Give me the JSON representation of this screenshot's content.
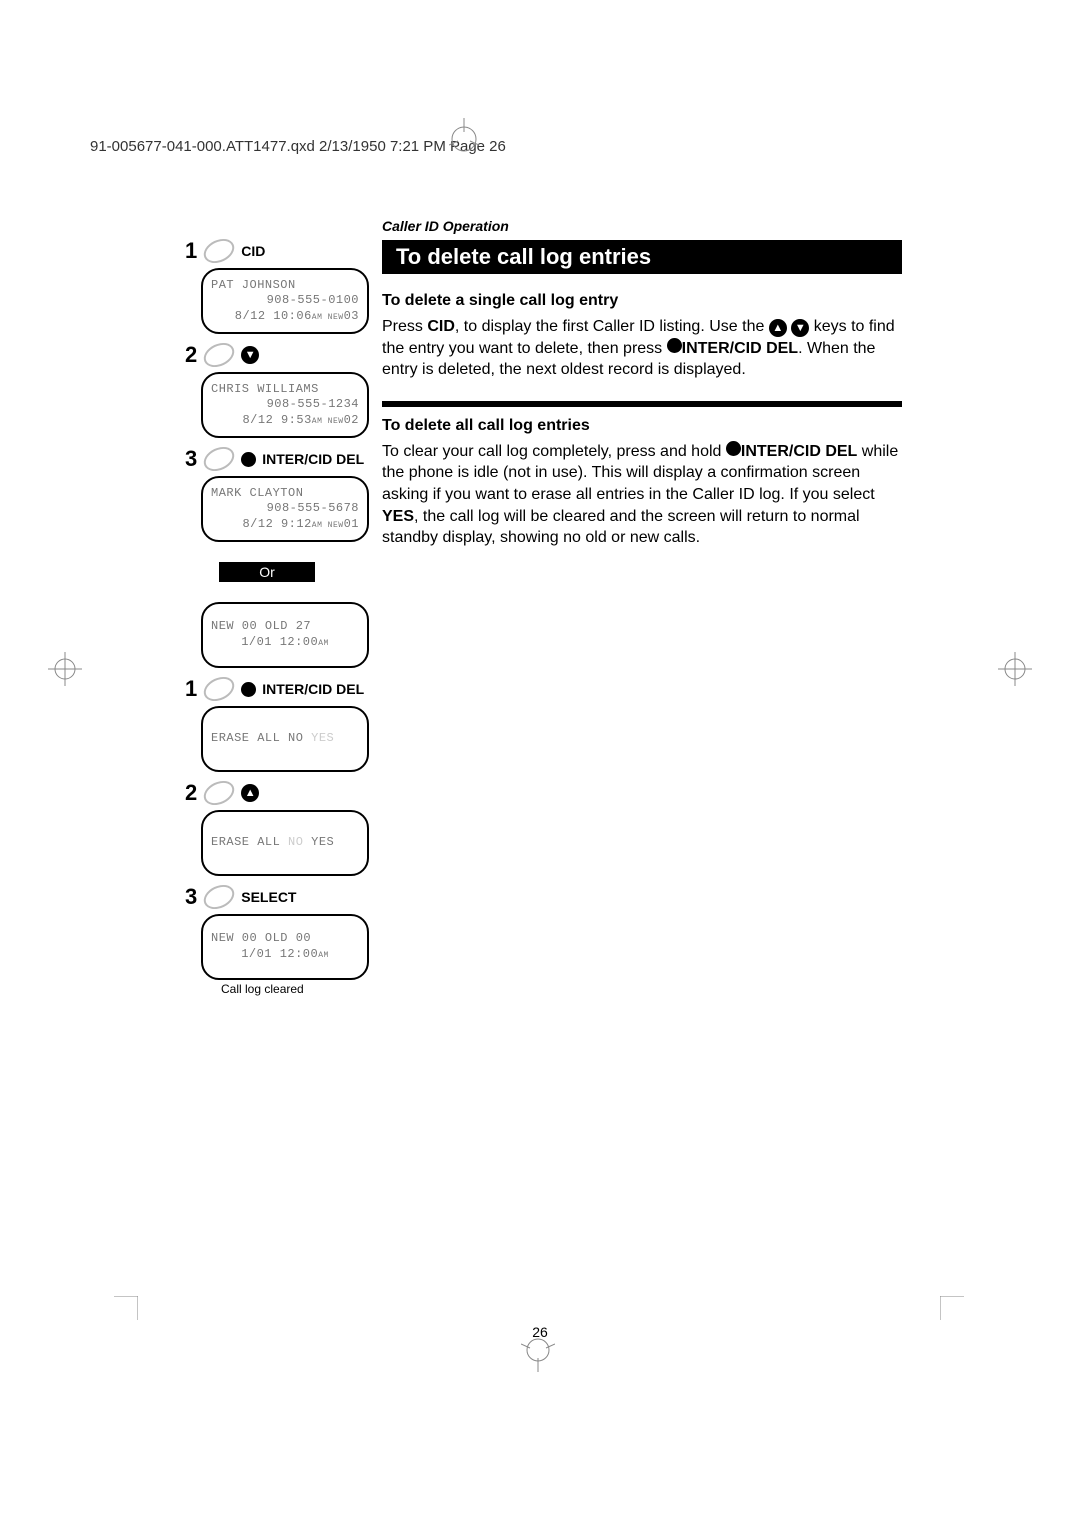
{
  "header_line": "91-005677-041-000.ATT1477.qxd  2/13/1950  7:21 PM  Page 26",
  "right": {
    "section_label": "Caller ID Operation",
    "title": "To delete call log entries",
    "sub1": "To delete a single call log entry",
    "para1a": "Press ",
    "para1_cid": "CID",
    "para1b": ", to display the first Caller ID listing. Use the ",
    "para1c": " keys to find the entry you want to delete, then press ",
    "para1_inter": "INTER/CID DEL",
    "para1d": ". When the entry is deleted, the next oldest record is displayed.",
    "sub2": "To delete all call log entries",
    "para2a": "To clear your call log completely, press and hold ",
    "para2_inter": "INTER/CID DEL",
    "para2b": " while the phone is idle (not in use). This will display a confirmation screen asking if you want to erase all entries in the Caller ID log. If you select ",
    "para2_yes": "YES",
    "para2c": ", the call log will be cleared and the screen will return to normal standby display, showing no old or new calls."
  },
  "left": {
    "step1a": "1",
    "step1a_label": "CID",
    "lcd1": {
      "r1": "PAT JOHNSON",
      "r2": "908-555-0100",
      "r3": "8/12 10:06",
      "r3sub": "AM NEW",
      "r3end": "03"
    },
    "step2a": "2",
    "lcd2": {
      "r1": "CHRIS WILLIAMS",
      "r2": "908-555-1234",
      "r3": "8/12 9:53",
      "r3sub": "AM NEW",
      "r3end": "02"
    },
    "step3a": "3",
    "step3a_label": "INTER/CID DEL",
    "lcd3": {
      "r1": "MARK CLAYTON",
      "r2": "908-555-5678",
      "r3": "8/12 9:12",
      "r3sub": "AM NEW",
      "r3end": "01"
    },
    "or": "Or",
    "lcd4": {
      "r1": "NEW 00  OLD 27",
      "r3": "1/01 12:00",
      "r3sub": "AM"
    },
    "step1b": "1",
    "step1b_label": "INTER/CID DEL",
    "lcd5": {
      "r1_pre": "ERASE ALL NO ",
      "r1_hi": "YES"
    },
    "step2b": "2",
    "lcd6": {
      "r1_pre": "ERASE ALL ",
      "r1_lo": "NO",
      "r1_hi": " YES"
    },
    "step3b": "3",
    "step3b_label": "SELECT",
    "lcd7": {
      "r1": "NEW 00  OLD 00",
      "r3": "1/01 12:00",
      "r3sub": "AM"
    },
    "caption": "Call log cleared"
  },
  "page_num": "26"
}
